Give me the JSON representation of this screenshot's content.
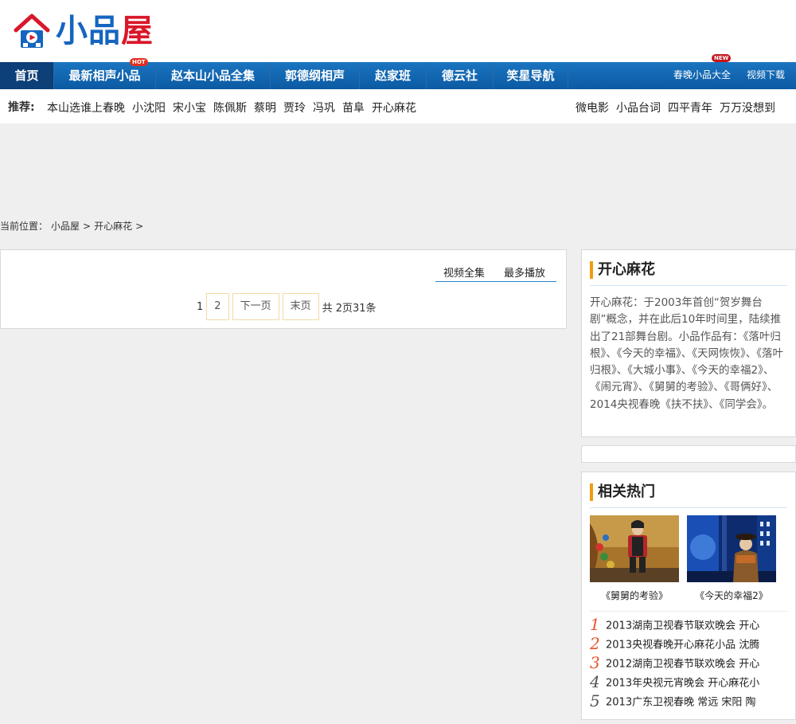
{
  "site": {
    "logo_text": "小品屋",
    "logo_char_1": "小",
    "logo_char_2": "品",
    "logo_char_3": "屋"
  },
  "nav": {
    "items": [
      "首页",
      "最新相声小品",
      "赵本山小品全集",
      "郭德纲相声",
      "赵家班",
      "德云社",
      "笑星导航"
    ],
    "hot_badge": "HOT",
    "new_badge": "NEW",
    "right_links": [
      "春晚小品大全",
      "视频下载"
    ]
  },
  "recommend": {
    "label": "推荐:",
    "left_links": [
      "本山选谁上春晚",
      "小沈阳",
      "宋小宝",
      "陈佩斯",
      "蔡明",
      "贾玲",
      "冯巩",
      "苗阜",
      "开心麻花"
    ],
    "right_links": [
      "微电影",
      "小品台词",
      "四平青年",
      "万万没想到"
    ]
  },
  "breadcrumb": {
    "prefix": "当前位置：",
    "items": [
      "小品屋",
      "开心麻花"
    ],
    "separator": ">"
  },
  "list": {
    "tabs": [
      "视频全集",
      "最多播放"
    ],
    "pager": {
      "current": "1",
      "pages": [
        "2"
      ],
      "next": "下一页",
      "last": "末页",
      "summary": "共 2页31条"
    }
  },
  "about": {
    "title": "开心麻花",
    "description": "开心麻花：于2003年首创“贺岁舞台剧”概念，并在此后10年时间里，陆续推出了21部舞台剧。小品作品有：《落叶归根》、《今天的幸福》、《天网恢恢》、《落叶归根》、《大城小事》、《今天的幸福2》、《闹元宵》、《舅舅的考验》、《哥俩好》、2014央视春晚《扶不扶》、《同学会》。"
  },
  "hot": {
    "title": "相关热门",
    "thumbs": [
      {
        "caption": "《舅舅的考验》"
      },
      {
        "caption": "《今天的幸福2》"
      }
    ],
    "list": [
      {
        "rank": "1",
        "text": "2013湖南卫视春节联欢晚会 开心"
      },
      {
        "rank": "2",
        "text": "2013央视春晚开心麻花小品 沈腾"
      },
      {
        "rank": "3",
        "text": "2012湖南卫视春节联欢晚会 开心"
      },
      {
        "rank": "4",
        "text": "2013年央视元宵晚会 开心麻花小"
      },
      {
        "rank": "5",
        "text": "2013广东卫视春晚 常远 宋阳 陶"
      }
    ]
  },
  "colors": {
    "nav_bg": "#0b5aa3",
    "nav_active": "#0d3f78",
    "accent_orange": "#f09b12",
    "brand_red": "#d9172b",
    "brand_blue": "#1565c0"
  }
}
